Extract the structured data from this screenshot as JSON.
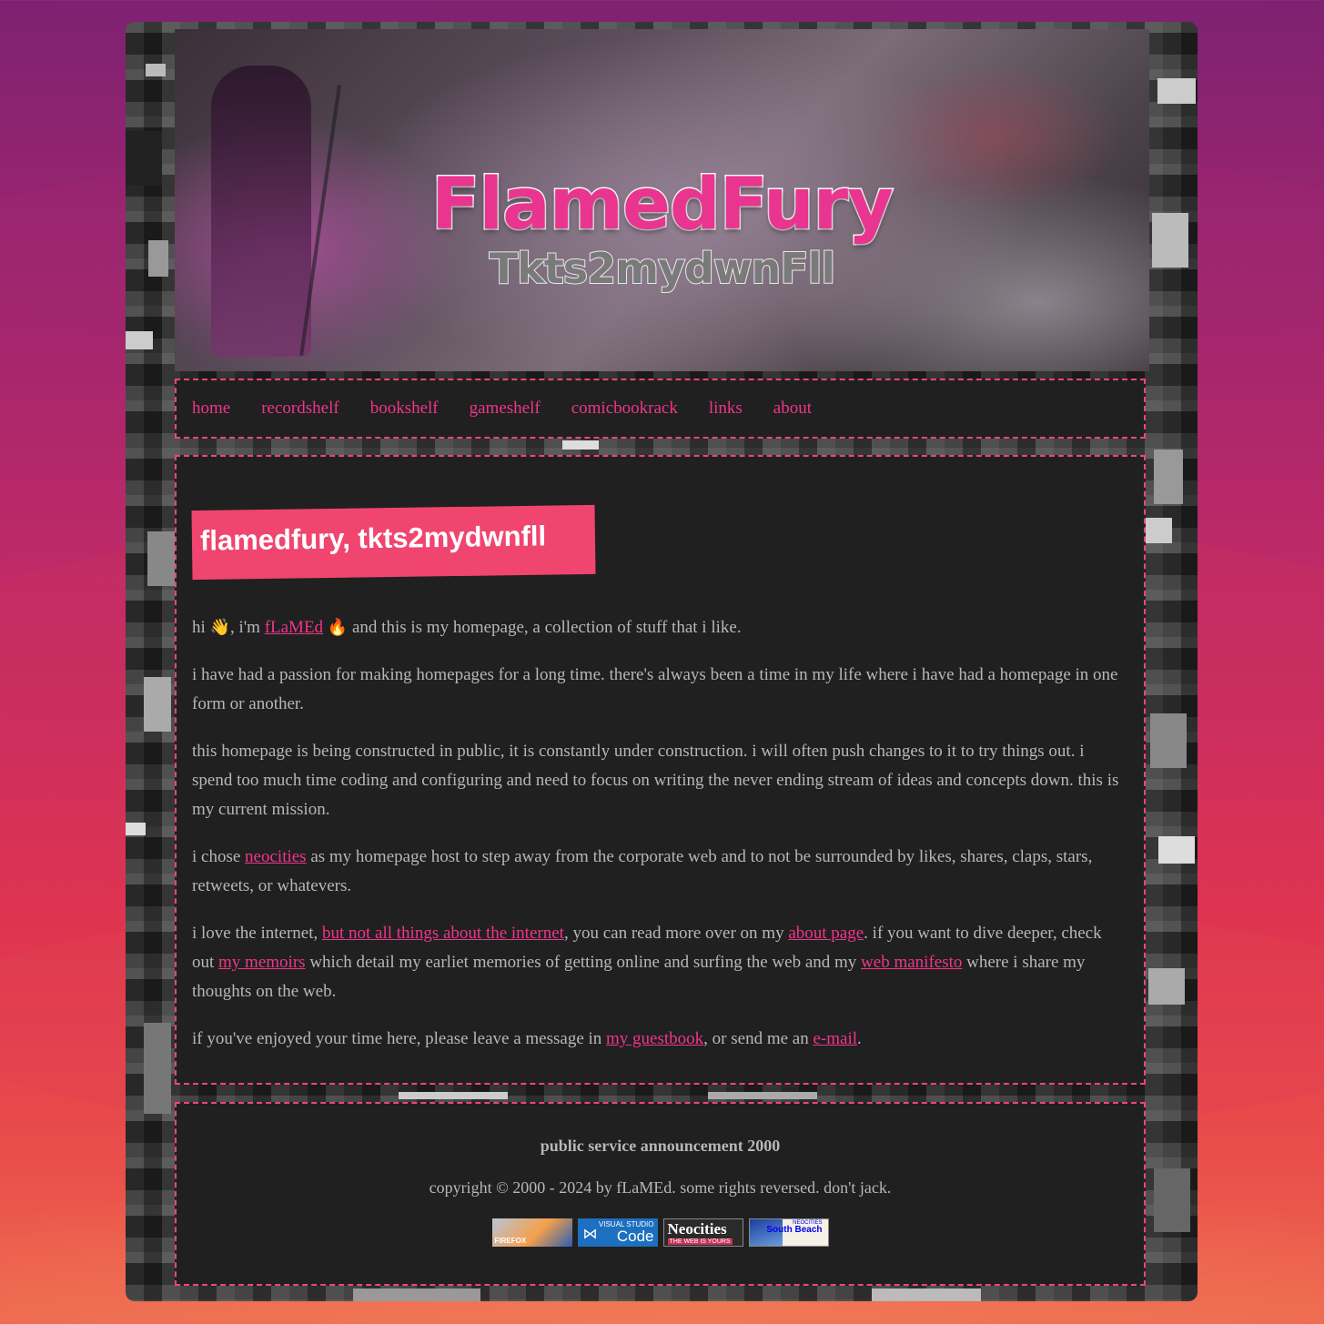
{
  "colors": {
    "accent": "#f0358a",
    "panel_bg": "#202020",
    "border": "#f0457a",
    "text": "#b7b7b7"
  },
  "banner": {
    "title": "FlamedFury",
    "subtitle": "Tkts2mydwnFll"
  },
  "nav": {
    "items": [
      "home",
      "recordshelf",
      "bookshelf",
      "gameshelf",
      "comicbookrack",
      "links",
      "about"
    ]
  },
  "main": {
    "heading": "flamedfury, tkts2mydwnfll",
    "p1": {
      "hi": "hi",
      "wave_emoji": "👋",
      "im": ", i'm",
      "name_link": "fLaMEd",
      "fire_emoji": "🔥",
      "rest": " and this is my homepage, a collection of stuff that i like."
    },
    "p2": "i have had a passion for making homepages for a long time. there's always been a time in my life where i have had a homepage in one form or another.",
    "p3": "this homepage is being constructed in public, it is constantly under construction. i will often push changes to it to try things out. i spend too much time coding and configuring and need to focus on writing the never ending stream of ideas and concepts down. this is my current mission.",
    "p4": {
      "a": "i chose ",
      "link": "neocities",
      "b": " as my homepage host to step away from the corporate web and to not be surrounded by likes, shares, claps, stars, retweets, or whatevers."
    },
    "p5": {
      "a": "i love the internet, ",
      "link1": "but not all things about the internet",
      "b": ", you can read more over on my ",
      "link2": "about page",
      "c": ". if you want to dive deeper, check out ",
      "link3": "my memoirs",
      "d": " which detail my earliet memories of getting online and surfing the web and my ",
      "link4": "web manifesto",
      "e": " where i share my thoughts on the web."
    },
    "p6": {
      "a": "if you've enjoyed your time here, please leave a message in ",
      "link1": "my guestbook",
      "b": ", or send me an ",
      "link2": "e-mail",
      "c": "."
    }
  },
  "footer": {
    "psa": "public service announcement 2000",
    "copyright": "copyright © 2000 - 2024 by fLaMEd. some rights reversed. don't jack.",
    "badges": {
      "firefox": "FIREFOX",
      "vscode_top": "VISUAL STUDIO",
      "vscode_main": "Code",
      "neocities_main": "Neocities",
      "neocities_sub": "THE WEB IS YOURS",
      "southbeach_top": "NEOCITIES",
      "southbeach_main": "South Beach"
    }
  }
}
